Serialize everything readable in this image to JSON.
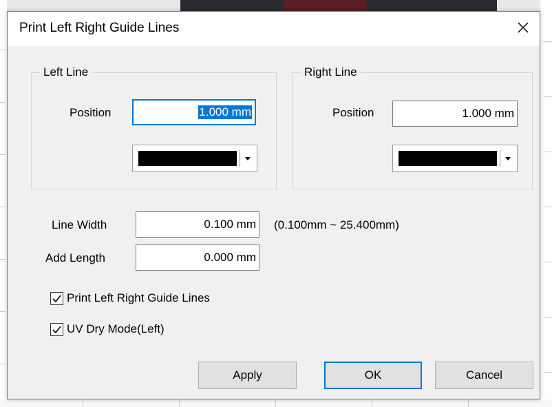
{
  "dialog": {
    "title": "Print Left Right Guide Lines",
    "close_icon": "close-icon"
  },
  "left_line": {
    "group_title": "Left Line",
    "position_label": "Position",
    "position_value": "1.000 mm",
    "color": "#000000"
  },
  "right_line": {
    "group_title": "Right Line",
    "position_label": "Position",
    "position_value": "1.000 mm",
    "color": "#000000"
  },
  "line_width": {
    "label": "Line Width",
    "value": "0.100 mm",
    "range_hint": "(0.100mm ~ 25.400mm)"
  },
  "add_length": {
    "label": "Add Length",
    "value": "0.000 mm"
  },
  "checkboxes": [
    {
      "label": "Print Left Right Guide Lines",
      "checked": true
    },
    {
      "label": "UV Dry Mode(Left)",
      "checked": true
    }
  ],
  "buttons": {
    "apply": "Apply",
    "ok": "OK",
    "cancel": "Cancel"
  },
  "colors": {
    "accent": "#0078d7",
    "dialog_bg": "#f0f0f0"
  }
}
